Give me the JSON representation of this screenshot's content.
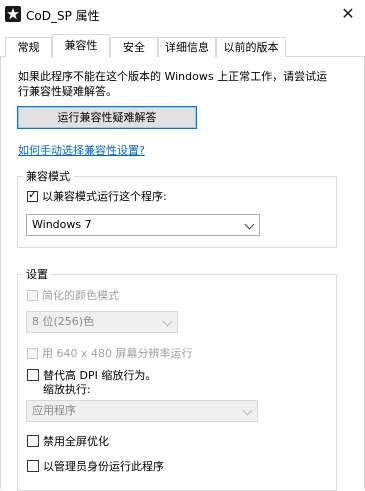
{
  "window": {
    "title": "CoD_SP 属性",
    "close_glyph": "✕"
  },
  "tabs": [
    "常规",
    "兼容性",
    "安全",
    "详细信息",
    "以前的版本"
  ],
  "intro": {
    "line1": "如果此程序不能在这个版本的 Windows 上正常工作，请尝试运",
    "line2": "行兼容性疑难解答。"
  },
  "troubleshoot_button": "运行兼容性疑难解答",
  "manual_link": "如何手动选择兼容性设置?",
  "compat_mode": {
    "legend": "兼容模式",
    "checkbox_label": "以兼容模式运行这个程序:",
    "checked": true,
    "selected_os": "Windows 7"
  },
  "settings": {
    "legend": "设置",
    "reduced_color": "简化的颜色模式",
    "color_depth": "8 位(256)色",
    "resolution": "用 640 x 480 屏幕分辨率运行",
    "dpi_line1": "替代高 DPI 缩放行为。",
    "dpi_line2": "缩放执行:",
    "dpi_select": "应用程序",
    "disable_fullscreen": "禁用全屏优化",
    "run_as_admin": "以管理员身份运行此程序"
  }
}
